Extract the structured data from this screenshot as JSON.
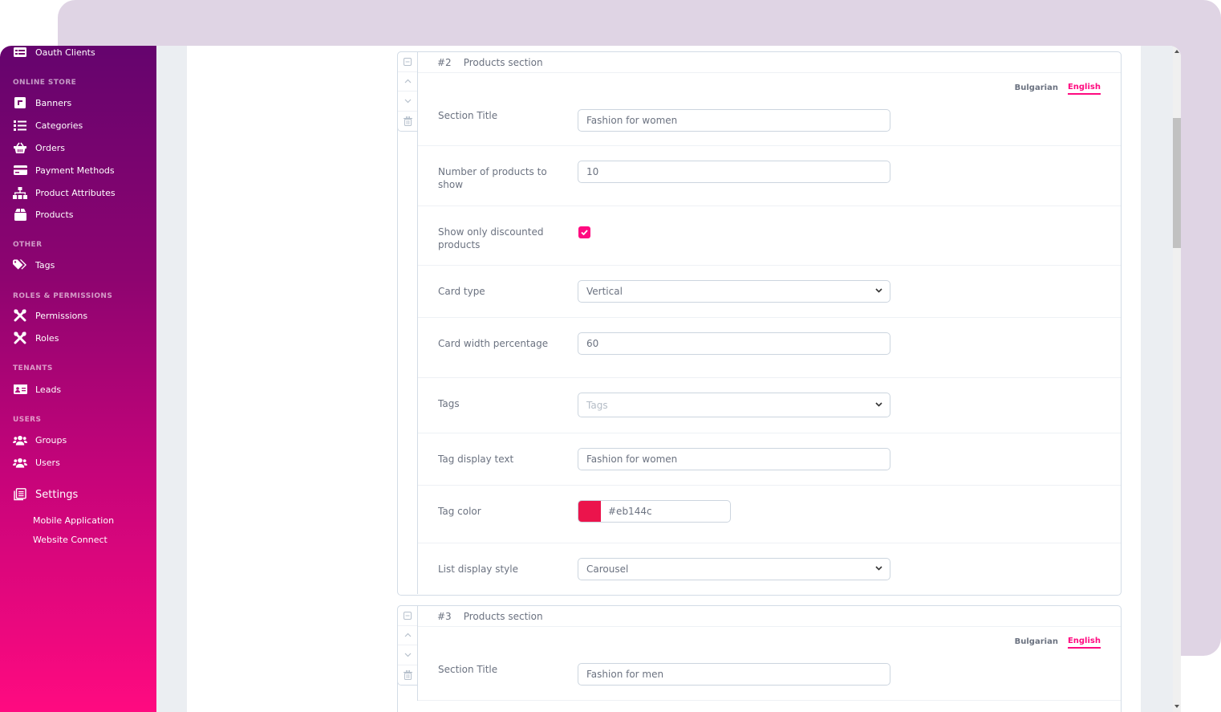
{
  "sidebar": {
    "top_item": {
      "label": "Oauth Clients",
      "icon": "table-icon"
    },
    "groups": [
      {
        "heading": "ONLINE STORE",
        "items": [
          {
            "label": "Banners",
            "icon": "banner-icon"
          },
          {
            "label": "Categories",
            "icon": "list-icon"
          },
          {
            "label": "Orders",
            "icon": "basket-icon"
          },
          {
            "label": "Payment Methods",
            "icon": "credit-card-icon"
          },
          {
            "label": "Product Attributes",
            "icon": "sitemap-icon"
          },
          {
            "label": "Products",
            "icon": "box-icon"
          }
        ]
      },
      {
        "heading": "OTHER",
        "items": [
          {
            "label": "Tags",
            "icon": "tags-icon"
          }
        ]
      },
      {
        "heading": "ROLES & PERMISSIONS",
        "items": [
          {
            "label": "Permissions",
            "icon": "tools-icon"
          },
          {
            "label": "Roles",
            "icon": "tools-icon"
          }
        ]
      },
      {
        "heading": "TENANTS",
        "items": [
          {
            "label": "Leads",
            "icon": "id-card-icon"
          }
        ]
      },
      {
        "heading": "USERS",
        "items": [
          {
            "label": "Groups",
            "icon": "users-icon"
          },
          {
            "label": "Users",
            "icon": "users-icon"
          }
        ]
      }
    ],
    "settings": {
      "label": "Settings",
      "icon": "document-icon",
      "children": [
        "Mobile Application",
        "Website Connect"
      ]
    }
  },
  "sections": [
    {
      "number": "#2",
      "title": "Products section",
      "languages": {
        "bulgarian": "Bulgarian",
        "english": "English",
        "active": "English"
      },
      "fields": {
        "section_title": {
          "label": "Section Title",
          "value": "Fashion for women"
        },
        "num_products": {
          "label": "Number of products to show",
          "value": "10"
        },
        "discounted": {
          "label": "Show only discounted products",
          "checked": true
        },
        "card_type": {
          "label": "Card type",
          "value": "Vertical"
        },
        "card_width": {
          "label": "Card width percentage",
          "value": "60"
        },
        "tags": {
          "label": "Tags",
          "placeholder": "Tags"
        },
        "tag_display_text": {
          "label": "Tag display text",
          "value": "Fashion for women"
        },
        "tag_color": {
          "label": "Tag color",
          "value": "#eb144c"
        },
        "list_display_style": {
          "label": "List display style",
          "value": "Carousel"
        }
      }
    },
    {
      "number": "#3",
      "title": "Products section",
      "languages": {
        "bulgarian": "Bulgarian",
        "english": "English",
        "active": "English"
      },
      "fields": {
        "section_title": {
          "label": "Section Title",
          "value": "Fashion for men"
        }
      }
    }
  ],
  "colors": {
    "accent": "#ff0a80",
    "tag_color_swatch": "#eb144c"
  }
}
